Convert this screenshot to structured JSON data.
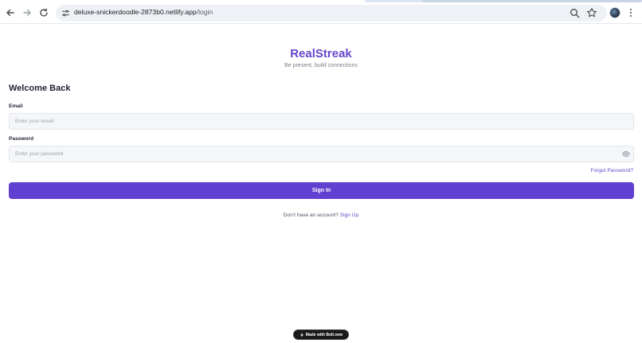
{
  "browser": {
    "url_host": "deluxe-snickerdoodle-2873b0.netlify.app",
    "url_path": "/login"
  },
  "app": {
    "brand": "RealStreak",
    "tagline": "Be present, build connections"
  },
  "login_form": {
    "heading": "Welcome Back",
    "email_label": "Email",
    "email_placeholder": "Enter your email",
    "email_value": "",
    "password_label": "Password",
    "password_placeholder": "Enter your password",
    "password_value": "",
    "forgot_password": "Forgot Password?",
    "submit_label": "Sign In",
    "signup_prompt": "Don't have an account?",
    "signup_link": "Sign Up"
  },
  "footer": {
    "badge": "Made with Bolt.new"
  },
  "colors": {
    "accent": "#6040d0",
    "brand_text": "#6747c9",
    "input_bg": "#f4f6f9"
  },
  "icons": [
    "back-arrow-icon",
    "forward-arrow-icon",
    "reload-icon",
    "site-info-icon",
    "zoom-icon",
    "star-icon",
    "profile-avatar",
    "more-menu-icon",
    "eye-icon",
    "lightning-icon"
  ]
}
